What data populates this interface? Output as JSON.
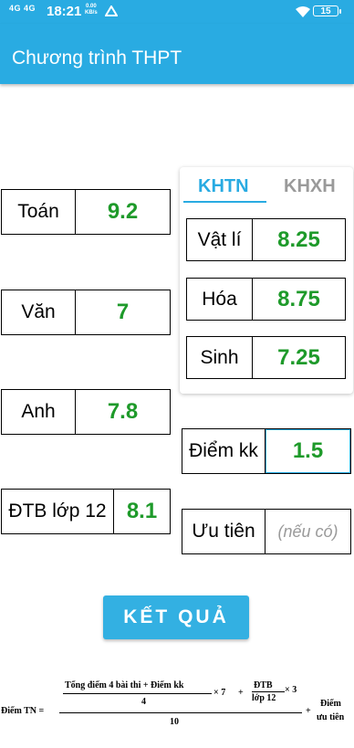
{
  "status_bar": {
    "signal": "4G 4G",
    "time": "18:21",
    "speed_value": "0.00",
    "speed_unit": "KB/s",
    "battery": "15"
  },
  "app": {
    "title": "Chương trình THPT"
  },
  "subjects": {
    "toan": {
      "label": "Toán",
      "value": "9.2"
    },
    "van": {
      "label": "Văn",
      "value": "7"
    },
    "anh": {
      "label": "Anh",
      "value": "7.8"
    },
    "dtb": {
      "label": "ĐTB lớp 12",
      "value": "8.1"
    }
  },
  "tabs": {
    "khtn": "KHTN",
    "khxh": "KHXH",
    "active": "KHTN"
  },
  "science": {
    "vatli": {
      "label": "Vật lí",
      "value": "8.25"
    },
    "hoa": {
      "label": "Hóa",
      "value": "8.75"
    },
    "sinh": {
      "label": "Sinh",
      "value": "7.25"
    }
  },
  "extra": {
    "diemkk": {
      "label": "Điểm kk",
      "value": "1.5"
    },
    "uutien": {
      "label": "Ưu tiên",
      "placeholder": "(nếu có)"
    }
  },
  "result_button": "KẾT QUẢ",
  "formula": {
    "lhs": "Điểm TN =",
    "numerator": "Tổng điểm 4 bài thi + Điểm kk",
    "denominator_4": "4",
    "times_7": "× 7",
    "plus1": "+",
    "dtb_top": "ĐTB",
    "dtb_bottom": "lớp 12",
    "times_3": "× 3",
    "denominator_10": "10",
    "plus2": "+",
    "uutien_top": "Điểm",
    "uutien_bottom": "ưu tiên"
  },
  "colors": {
    "accent": "#29abe2",
    "score_green": "#1e9a2a",
    "inactive_tab": "#9a9a9a"
  }
}
